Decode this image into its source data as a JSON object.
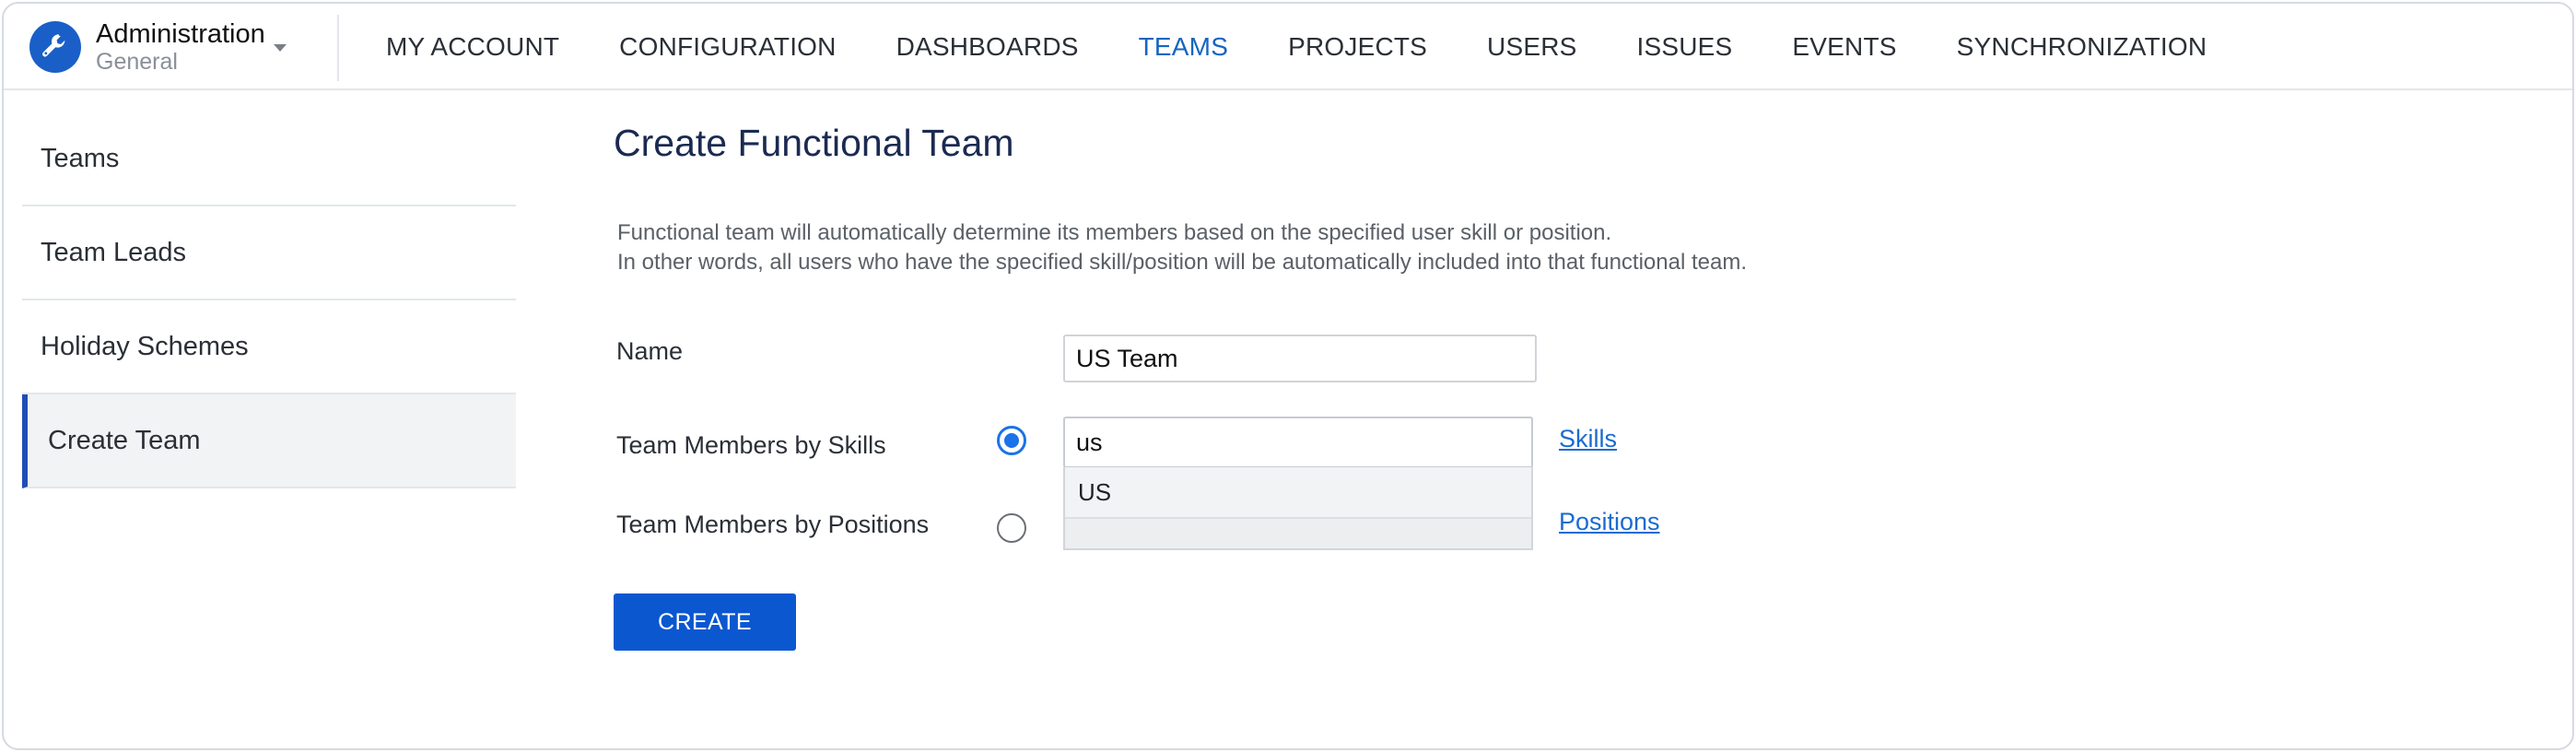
{
  "brand": {
    "title": "Administration",
    "subtitle": "General",
    "logo_icon": "wrench-icon",
    "caret_icon": "caret-down-icon"
  },
  "nav": {
    "items": [
      "MY ACCOUNT",
      "CONFIGURATION",
      "DASHBOARDS",
      "TEAMS",
      "PROJECTS",
      "USERS",
      "ISSUES",
      "EVENTS",
      "SYNCHRONIZATION"
    ],
    "active": "TEAMS"
  },
  "sidebar": {
    "items": [
      {
        "label": "Teams"
      },
      {
        "label": "Team Leads"
      },
      {
        "label": "Holiday Schemes"
      },
      {
        "label": "Create Team"
      }
    ],
    "active": "Create Team"
  },
  "form": {
    "title": "Create Functional Team",
    "description_1": "Functional team will automatically determine its members based on the specified user skill or position.",
    "description_2": "In other words, all users who have the specified skill/position will be automatically included into that functional team.",
    "name_label": "Name",
    "name_value": "US Team",
    "skills_label": "Team Members by Skills",
    "skills_value": "us",
    "skills_selected": true,
    "skills_link": "Skills",
    "positions_label": "Team Members by Positions",
    "positions_selected": false,
    "positions_link": "Positions",
    "suggestions": [
      "US"
    ],
    "create_label": "CREATE"
  },
  "colors": {
    "accent": "#1565c0",
    "button": "#0b57d0",
    "brand": "#1a5fc7",
    "sidebar_active_bar": "#1f4db5"
  }
}
